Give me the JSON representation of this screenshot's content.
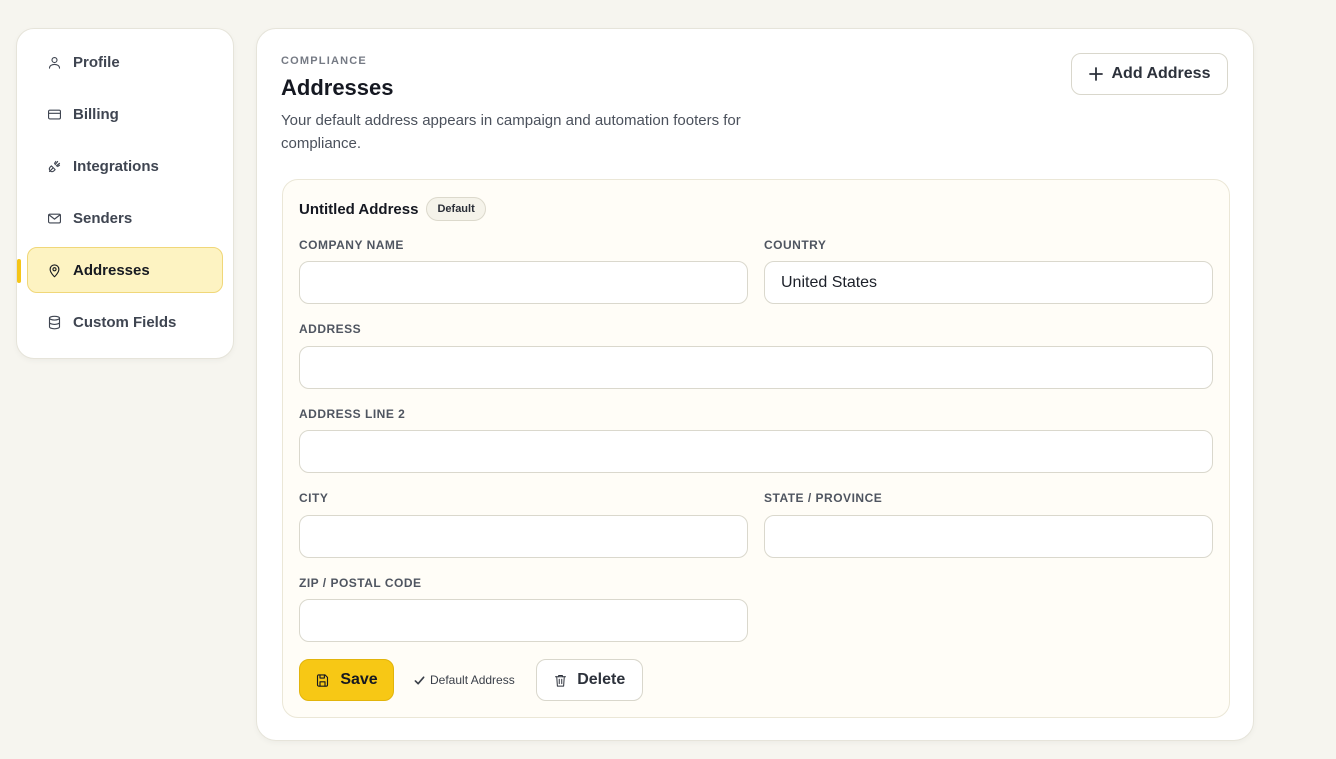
{
  "sidebar": {
    "items": [
      {
        "label": "Profile",
        "icon": "user-icon",
        "active": false
      },
      {
        "label": "Billing",
        "icon": "credit-card-icon",
        "active": false
      },
      {
        "label": "Integrations",
        "icon": "plug-icon",
        "active": false
      },
      {
        "label": "Senders",
        "icon": "mail-icon",
        "active": false
      },
      {
        "label": "Addresses",
        "icon": "map-pin-icon",
        "active": true
      },
      {
        "label": "Custom Fields",
        "icon": "database-icon",
        "active": false
      }
    ]
  },
  "header": {
    "eyebrow": "COMPLIANCE",
    "title": "Addresses",
    "description": "Your default address appears in campaign and automation footers for compliance.",
    "add_button_label": "Add Address"
  },
  "address": {
    "name": "Untitled Address",
    "badge": "Default",
    "fields": {
      "company_name": {
        "label": "COMPANY NAME",
        "value": ""
      },
      "country": {
        "label": "COUNTRY",
        "value": "United States"
      },
      "address": {
        "label": "ADDRESS",
        "value": ""
      },
      "address_line_2": {
        "label": "ADDRESS LINE 2",
        "value": ""
      },
      "city": {
        "label": "CITY",
        "value": ""
      },
      "state": {
        "label": "STATE / PROVINCE",
        "value": ""
      },
      "zip": {
        "label": "ZIP / POSTAL CODE",
        "value": ""
      }
    },
    "actions": {
      "save_label": "Save",
      "default_label": "Default Address",
      "delete_label": "Delete"
    }
  },
  "colors": {
    "accent": "#f7c815",
    "active_bg": "#fdf3c2",
    "page_bg": "#f6f5ef"
  }
}
